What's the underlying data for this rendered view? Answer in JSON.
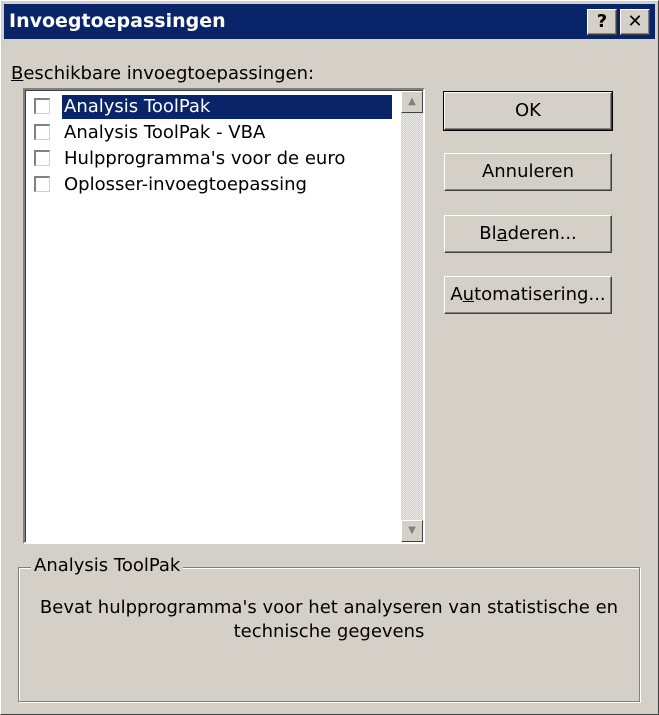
{
  "window": {
    "title": "Invoegtoepassingen",
    "help_glyph": "?",
    "close_glyph": "✕"
  },
  "addins": {
    "label_accel": "B",
    "label_rest": "eschikbare invoegtoepassingen:",
    "items": [
      {
        "label": "Analysis ToolPak",
        "checked": false,
        "selected": true
      },
      {
        "label": "Analysis ToolPak - VBA",
        "checked": false,
        "selected": false
      },
      {
        "label": "Hulpprogramma's voor de euro",
        "checked": false,
        "selected": false
      },
      {
        "label": "Oplosser-invoegtoepassing",
        "checked": false,
        "selected": false
      }
    ]
  },
  "buttons": {
    "ok": "OK",
    "cancel": "Annuleren",
    "browse_pre": "Bl",
    "browse_accel": "a",
    "browse_post": "deren...",
    "auto_pre": "A",
    "auto_accel": "u",
    "auto_post": "tomatisering..."
  },
  "description": {
    "title": "Analysis ToolPak",
    "text": "Bevat hulpprogramma's voor het analyseren van statistische en technische gegevens"
  },
  "colors": {
    "face": "#d4d0c8",
    "titlebar": "#0a246a",
    "selection": "#0a246a"
  }
}
